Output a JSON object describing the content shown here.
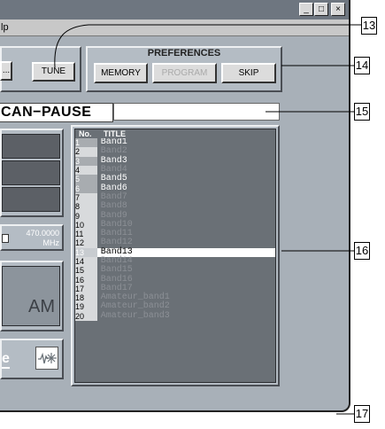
{
  "menubar": {
    "partial_item": "lp"
  },
  "window_controls": {
    "minimize": "_",
    "maximize": "□",
    "close": "×"
  },
  "toolbar": {
    "partial_button": "...",
    "tune_button": "TUNE"
  },
  "preferences": {
    "title": "PREFERENCES",
    "memory": "MEMORY",
    "program": "PROGRAM",
    "skip": "SKIP"
  },
  "status": {
    "text": "CAN−PAUSE"
  },
  "frequency": {
    "value": "470.0000",
    "unit": "MHz"
  },
  "mode": {
    "value": "AM"
  },
  "left_panel": {
    "partial_text": "e"
  },
  "list": {
    "header_no": "No.",
    "header_title": "TITLE",
    "selected_index": 12,
    "rows": [
      {
        "no": "1",
        "title": "Band1",
        "active": true
      },
      {
        "no": "2",
        "title": "Band2",
        "active": false
      },
      {
        "no": "3",
        "title": "Band3",
        "active": true
      },
      {
        "no": "4",
        "title": "Band4",
        "active": false
      },
      {
        "no": "5",
        "title": "Band5",
        "active": true
      },
      {
        "no": "6",
        "title": "Band6",
        "active": true
      },
      {
        "no": "7",
        "title": "Band7",
        "active": false
      },
      {
        "no": "8",
        "title": "Band8",
        "active": false
      },
      {
        "no": "9",
        "title": "Band9",
        "active": false
      },
      {
        "no": "10",
        "title": "Band10",
        "active": false
      },
      {
        "no": "11",
        "title": "Band11",
        "active": false
      },
      {
        "no": "12",
        "title": "Band12",
        "active": false
      },
      {
        "no": "13",
        "title": "Band13",
        "active": true
      },
      {
        "no": "14",
        "title": "Band14",
        "active": false
      },
      {
        "no": "15",
        "title": "Band15",
        "active": false
      },
      {
        "no": "16",
        "title": "Band16",
        "active": false
      },
      {
        "no": "17",
        "title": "Band17",
        "active": false
      },
      {
        "no": "18",
        "title": "Amateur_band1",
        "active": false
      },
      {
        "no": "19",
        "title": "Amateur_band2",
        "active": false
      },
      {
        "no": "20",
        "title": "Amateur_band3",
        "active": false
      }
    ]
  },
  "callouts": {
    "c13": "13",
    "c14": "14",
    "c15": "15",
    "c16": "16",
    "c17": "17"
  },
  "colors": {
    "window_bg": "#a8b0b8",
    "lcd_bg": "#5c6066",
    "active_text": "#ffffff",
    "inactive_text": "#8c9096",
    "selected_bg": "#ffffff",
    "selected_text": "#000000"
  }
}
